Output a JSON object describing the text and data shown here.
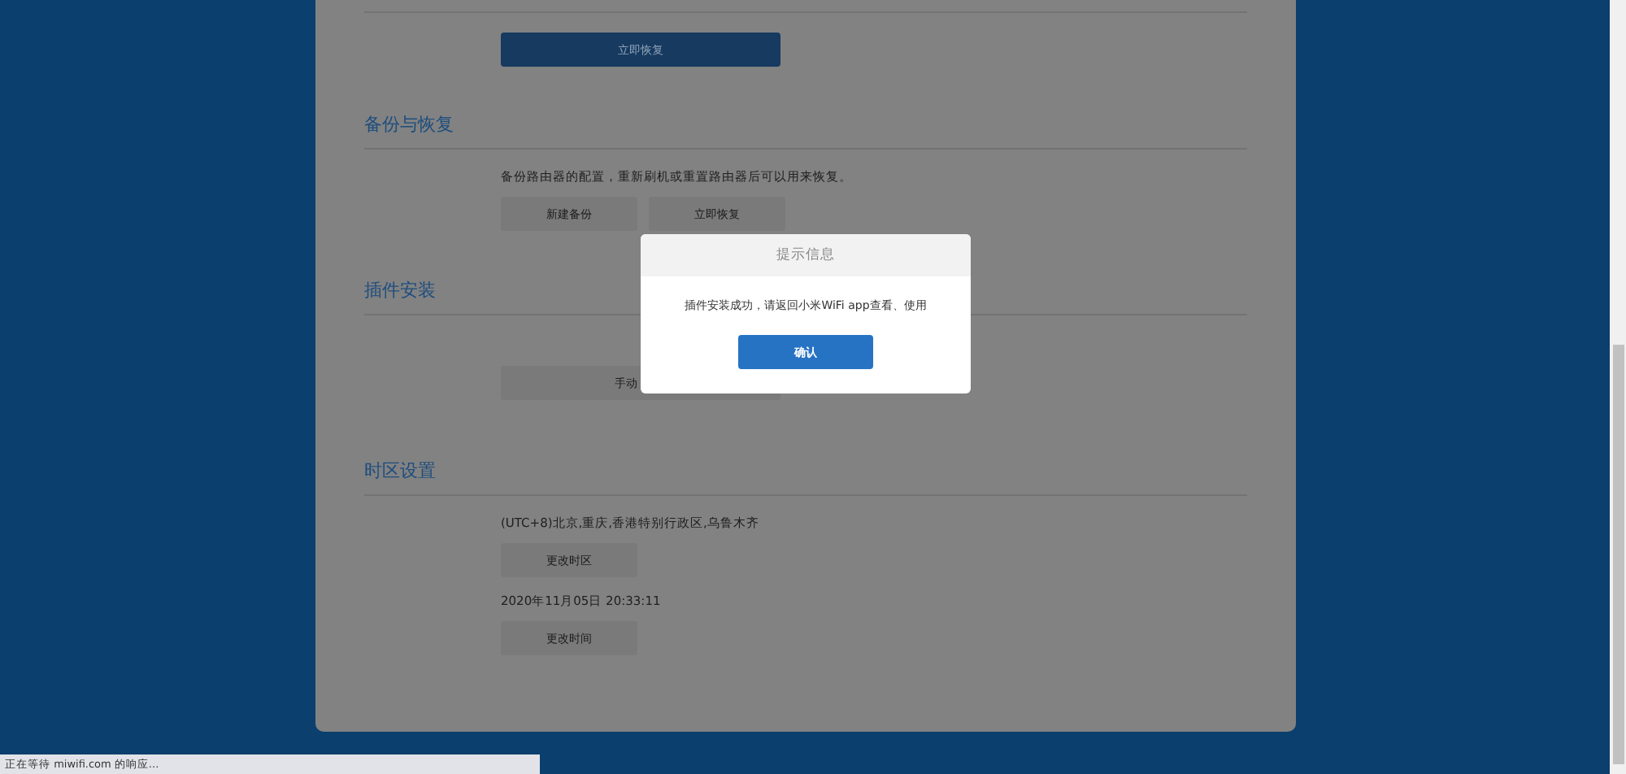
{
  "top_section": {
    "button": "立即恢复"
  },
  "sections": [
    {
      "kind": "backup",
      "title": "备份与恢复",
      "description": "备份路由器的配置，重新刷机或重置路由器后可以用来恢复。",
      "buttons": [
        "新建备份",
        "立即恢复"
      ]
    },
    {
      "kind": "plugin",
      "title": "插件安装",
      "buttons": [
        "手动"
      ]
    },
    {
      "kind": "timezone",
      "title": "时区设置",
      "timezone": "(UTC+8)北京,重庆,香港特别行政区,乌鲁木齐",
      "timezone_button": "更改时区",
      "datetime": "2020年11月05日 20:33:11",
      "datetime_button": "更改时间"
    }
  ],
  "dialog": {
    "title": "提示信息",
    "message": "插件安装成功，请返回小米WiFi app查看、使用",
    "button": "确认"
  },
  "status_bar": "正在等待 miwifi.com 的响应..."
}
